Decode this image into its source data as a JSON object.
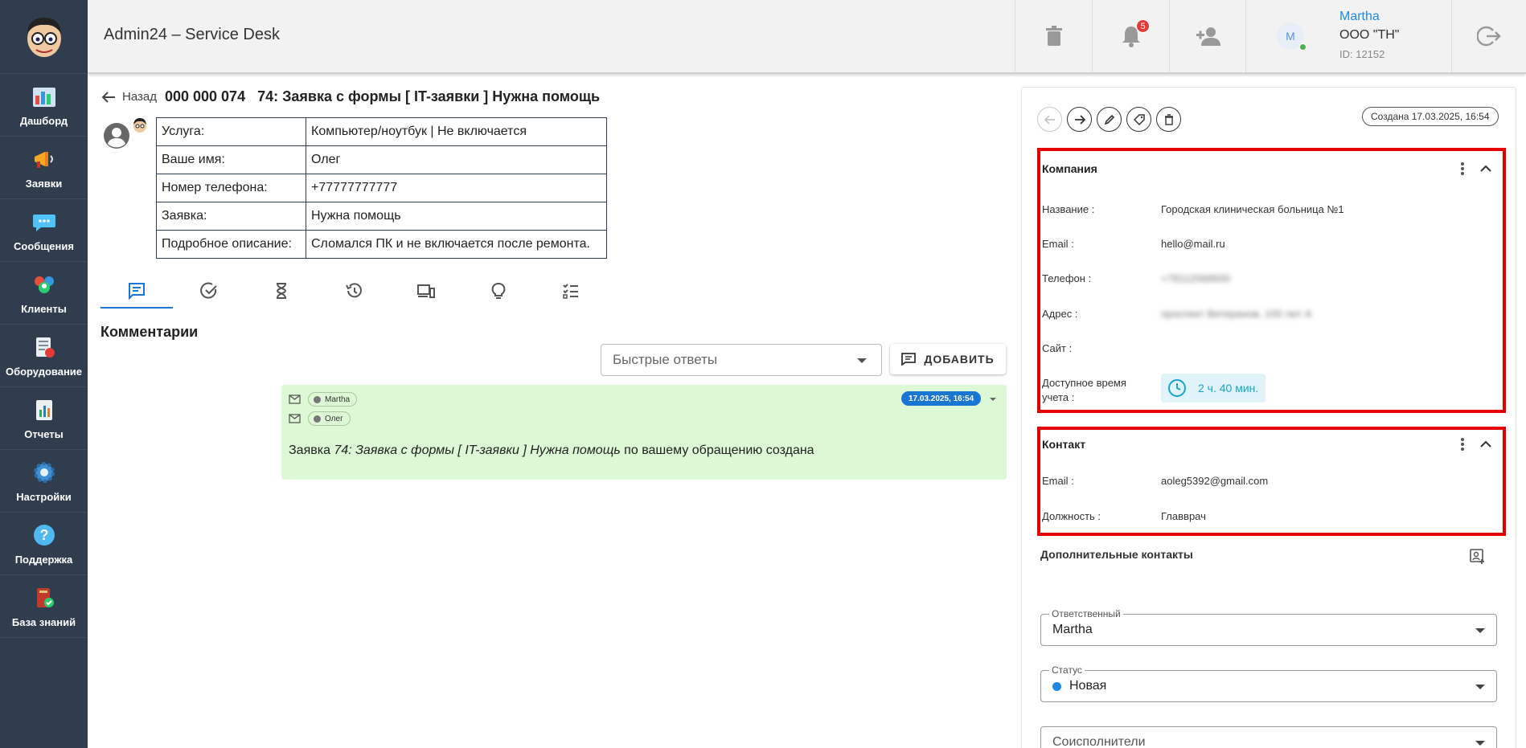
{
  "app": {
    "title": "Admin24 – Service Desk"
  },
  "sidebar": {
    "items": [
      {
        "label": "Дашборд",
        "icon": "dashboard-icon"
      },
      {
        "label": "Заявки",
        "icon": "megaphone-icon"
      },
      {
        "label": "Сообщения",
        "icon": "chat-bubble-icon"
      },
      {
        "label": "Клиенты",
        "icon": "clients-icon"
      },
      {
        "label": "Оборудование",
        "icon": "equipment-icon"
      },
      {
        "label": "Отчеты",
        "icon": "report-icon"
      },
      {
        "label": "Настройки",
        "icon": "gear-icon"
      },
      {
        "label": "Поддержка",
        "icon": "help-icon"
      },
      {
        "label": "База знаний",
        "icon": "knowledge-base-icon"
      }
    ]
  },
  "header": {
    "notifications_count": "5",
    "user": {
      "avatar_letter": "M",
      "name": "Martha",
      "org": "ООО \"TH\"",
      "id": "ID: 12152"
    }
  },
  "ticket": {
    "back_label": "Назад",
    "title": "000 000 074   74: Заявка с формы [ IT-заявки ] Нужна помощь",
    "fields": [
      {
        "key": "Услуга:",
        "value": "Компьютер/ноутбук | Не включается"
      },
      {
        "key": "Ваше имя:",
        "value": "Олег"
      },
      {
        "key": "Номер телефона:",
        "value": "+77777777777"
      },
      {
        "key": "Заявка:",
        "value": "Нужна помощь"
      },
      {
        "key": "Подробное описание:",
        "value": "Сломался ПК и не включается после ремонта."
      }
    ]
  },
  "tabs": [
    "comments-icon",
    "check-icon",
    "hourglass-icon",
    "history-icon",
    "devices-icon",
    "lightbulb-icon",
    "checklist-icon"
  ],
  "comments": {
    "title": "Комментарии",
    "quick_replies_placeholder": "Быстрые ответы",
    "add_label": "ДОБАВИТЬ",
    "message": {
      "from": "Martha",
      "to": "Олег",
      "date": "17.03.2025, 16:54",
      "text_prefix": "Заявка ",
      "text_italic": "74: Заявка с формы [ IT-заявки ] Нужна помощь",
      "text_suffix": " по вашему обращению создана"
    }
  },
  "panel": {
    "created": "Создана 17.03.2025, 16:54",
    "company": {
      "title": "Компания",
      "name_label": "Название :",
      "name": "Городская клиническая больница №1",
      "email_label": "Email :",
      "email": "hello@mail.ru",
      "phone_label": "Телефон :",
      "phone": "+78112068600",
      "address_label": "Адрес :",
      "address": "проспект Ветеранов, 100 лит А",
      "site_label": "Сайт :",
      "time_label": "Доступное время учета :",
      "time": "2 ч. 40 мин."
    },
    "contact": {
      "title": "Контакт",
      "email_label": "Email :",
      "email": "aoleg5392@gmail.com",
      "position_label": "Должность :",
      "position": "Главврач"
    },
    "extra_contacts_title": "Дополнительные контакты",
    "responsible": {
      "label": "Ответственный",
      "value": "Martha"
    },
    "status": {
      "label": "Статус",
      "value": "Новая",
      "color": "#1e88e5"
    },
    "coexecutors_placeholder": "Соисполнители"
  }
}
